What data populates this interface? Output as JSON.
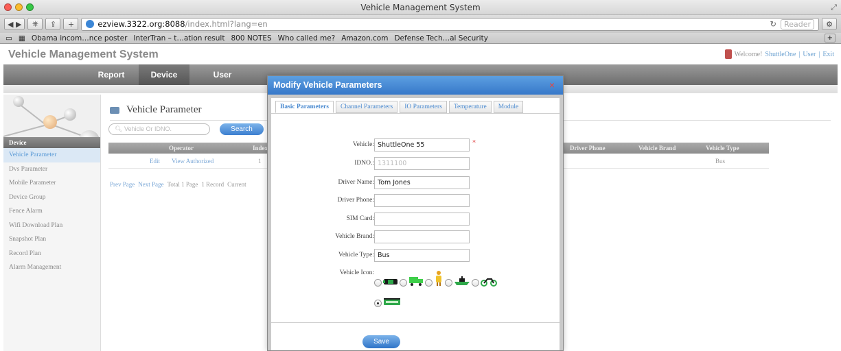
{
  "browser": {
    "window_title": "Vehicle Management System",
    "url_host": "ezview.3322.org:8088",
    "url_path": "/index.html?lang=en",
    "reader_label": "Reader",
    "bookmarks": [
      "Obama incom…nce poster",
      "InterTran – t…ation result",
      "800 NOTES",
      "Who called me?",
      "Amazon.com",
      "Defense Tech…al Security"
    ]
  },
  "app": {
    "title": "Vehicle Management System",
    "welcome": "Welcome!",
    "user_name": "ShuttleOne",
    "user_link": "User",
    "exit_link": "Exit",
    "separator": "|"
  },
  "nav": {
    "report": "Report",
    "device": "Device",
    "user": "User"
  },
  "sidebar": {
    "section": "Device",
    "items": [
      "Vehicle Parameter",
      "Dvs Parameter",
      "Mobile Parameter",
      "Device Group",
      "Fence Alarm",
      "Wifi Download Plan",
      "Snapshot Plan",
      "Record Plan",
      "Alarm Management"
    ],
    "active_index": 0
  },
  "main": {
    "heading": "Vehicle Parameter",
    "search_placeholder": "Vehicle Or IDNO.",
    "search_button": "Search",
    "columns": {
      "operator": "Operator",
      "index": "Index",
      "driver_phone": "Driver Phone",
      "vehicle_brand": "Vehicle Brand",
      "vehicle_type": "Vehicle Type"
    },
    "row": {
      "edit": "Edit",
      "view_authorized": "View Authorized",
      "index": "1",
      "vehicle_type": "Bus"
    },
    "pager": {
      "prev": "Prev Page",
      "next": "Next Page",
      "total": "Total 1 Page",
      "records": "1 Record",
      "current": "Current"
    }
  },
  "modal": {
    "title": "Modify Vehicle Parameters",
    "close": "×",
    "tabs": [
      "Basic Parameters",
      "Channel Parameters",
      "IO Parameters",
      "Temperature",
      "Module"
    ],
    "fields": {
      "vehicle_label": "Vehicle:",
      "vehicle_value": "ShuttleOne 55",
      "idno_label": "IDNO.:",
      "idno_value": "1311100",
      "driver_name_label": "Driver Name:",
      "driver_name_value": "Tom Jones",
      "driver_phone_label": "Driver Phone:",
      "driver_phone_value": "",
      "sim_label": "SIM Card:",
      "sim_value": "",
      "brand_label": "Vehicle Brand:",
      "brand_value": "",
      "type_label": "Vehicle Type:",
      "type_value": "Bus",
      "icon_label": "Vehicle Icon:"
    },
    "required_mark": "*",
    "icons": [
      "car-icon",
      "truck-icon",
      "person-icon",
      "boat-icon",
      "motorcycle-icon",
      "bus-icon"
    ],
    "selected_icon": "bus-icon",
    "save": "Save"
  }
}
